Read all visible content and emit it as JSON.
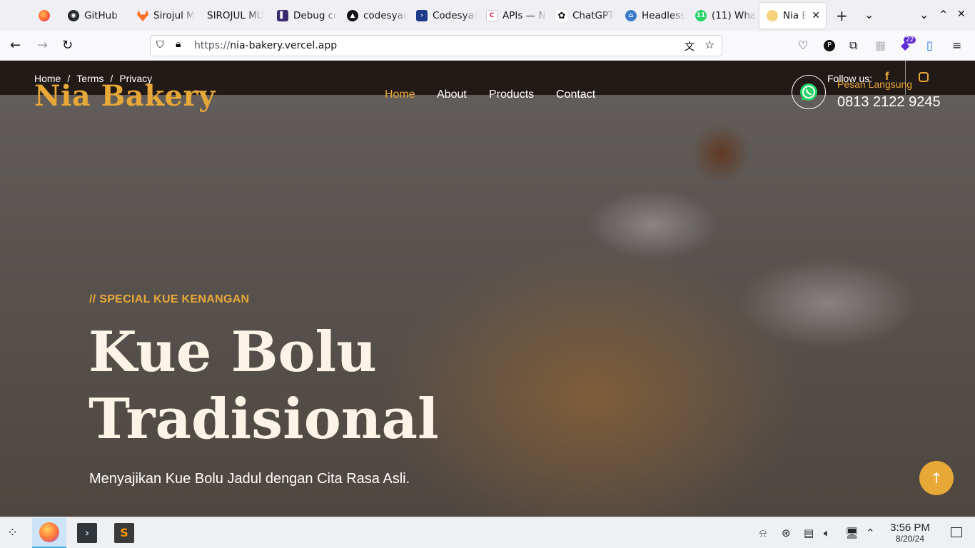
{
  "browser": {
    "tabs": [
      {
        "label": ""
      },
      {
        "label": "GitHub -"
      },
      {
        "label": "Sirojul M"
      },
      {
        "label": "SIROJUL MU"
      },
      {
        "label": "Debug cc"
      },
      {
        "label": "codesyar"
      },
      {
        "label": "Codesyar"
      },
      {
        "label": "APIs — N"
      },
      {
        "label": "ChatGPT"
      },
      {
        "label": "Headless"
      },
      {
        "label": "(11) Wha"
      },
      {
        "label": "Nia Ba"
      }
    ],
    "url_scheme": "https://",
    "url_host": "nia-bakery.vercel.app",
    "extension_badge": "22"
  },
  "site": {
    "breadcrumb": [
      "Home",
      "Terms",
      "Privacy"
    ],
    "breadcrumb_sep": "/",
    "logo": "Nia Bakery",
    "menu": [
      "Home",
      "About",
      "Products",
      "Contact"
    ],
    "follow_label": "Follow us:",
    "order_label": "Pesan Langsung",
    "phone": "0813 2122 9245",
    "hero": {
      "kicker": "// SPECIAL KUE KENANGAN",
      "title_line1": "Kue Bolu",
      "title_line2": "Tradisional",
      "subtitle": "Menyajikan Kue Bolu Jadul dengan Cita Rasa Asli."
    },
    "accent_color": "#e8a838"
  },
  "taskbar": {
    "time": "3:56 PM",
    "date": "8/20/24"
  }
}
